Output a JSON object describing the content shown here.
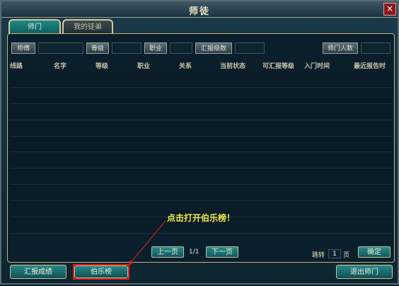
{
  "window": {
    "title": "师徒",
    "close_glyph": "×"
  },
  "tabs": [
    {
      "label": "师门",
      "active": true
    },
    {
      "label": "我的徒弟",
      "active": false
    }
  ],
  "filters": {
    "master_label": "师傅",
    "level_label": "等级",
    "job_label": "职业",
    "report_level_label": "汇报级数",
    "member_count_label": "师门人数"
  },
  "table": {
    "columns": [
      "线路",
      "名字",
      "等级",
      "职业",
      "关系",
      "当前状态",
      "可汇报等级",
      "入门时间",
      "最近报告时"
    ],
    "rows": []
  },
  "pagination": {
    "prev_label": "上一页",
    "page_indicator": "1/1",
    "next_label": "下一页",
    "jump_label": "跳转",
    "jump_value": "1",
    "page_suffix": "页",
    "confirm_label": "确定"
  },
  "actions": {
    "report_label": "汇报成绩",
    "bole_label": "伯乐榜",
    "quit_label": "退出师门"
  },
  "annotation": {
    "hint_text": "点击打开伯乐榜！",
    "color": "#e0201c"
  }
}
